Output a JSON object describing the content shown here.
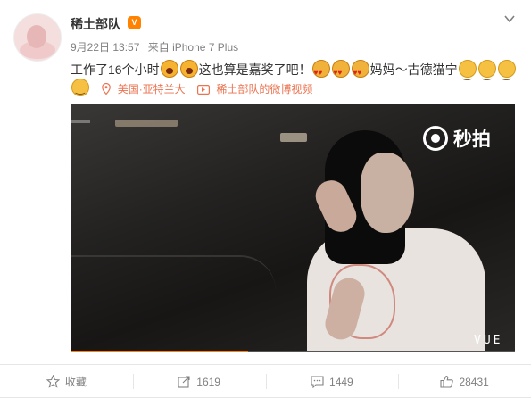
{
  "post": {
    "author": "稀土部队",
    "vip_badge": "V",
    "timestamp": "9月22日 13:57",
    "source": "来自 iPhone 7 Plus",
    "text_1": "工作了16个小时",
    "text_2": "这也算是嘉奖了吧！",
    "text_3": "妈妈～古德猫宁",
    "location": "美国·亚特兰大",
    "video_link": "稀土部队的微博视频"
  },
  "video": {
    "watermark": "秒拍",
    "brand": "VUE",
    "progress_percent": 40
  },
  "toolbar": {
    "favorite_label": "收藏",
    "repost_count": "1619",
    "comment_count": "1449",
    "like_count": "28431"
  },
  "colors": {
    "accent": "#eb7350",
    "progress": "#ff8200"
  }
}
